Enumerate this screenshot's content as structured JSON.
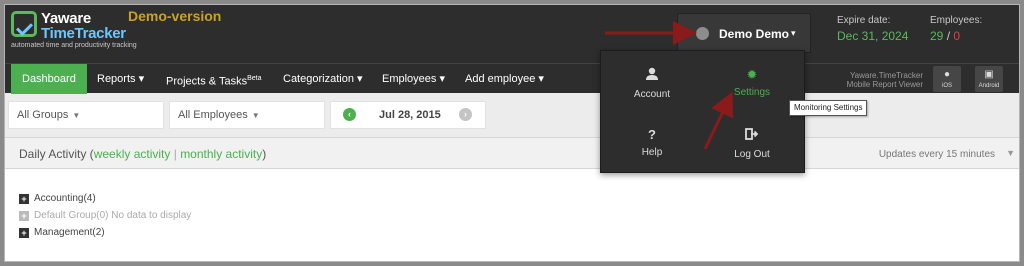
{
  "logo": {
    "line1": "Yaware",
    "line2": "TimeTracker",
    "tagline": "automated time and productivity tracking",
    "demo_label": "Demo-version"
  },
  "user": {
    "name": "Demo Demo",
    "caret": "▾"
  },
  "account_info": {
    "expire_label": "Expire date:",
    "expire_value": "Dec 31, 2024",
    "employees_label": "Employees:",
    "employees_active": "29",
    "employees_sep": "/",
    "employees_inactive": "0"
  },
  "nav": {
    "dashboard": "Dashboard",
    "reports": "Reports ▾",
    "projects": "Projects & Tasks",
    "projects_badge": "Beta",
    "categorization": "Categorization ▾",
    "employees": "Employees ▾",
    "add_employee": "Add employee ▾",
    "mobile_line1": "Yaware.TimeTracker",
    "mobile_line2": "Mobile Report Viewer",
    "ios_label": "iOS",
    "android_label": "Android"
  },
  "filters": {
    "groups": "All Groups",
    "employees": "All Employees",
    "date": "Jul 28, 2015"
  },
  "activity": {
    "title": "Daily Activity (",
    "weekly": "weekly activity",
    "sep": "|",
    "monthly": "monthly activity",
    "close": ")",
    "updates": "Updates every 15 minutes",
    "groups": [
      {
        "label": "Accounting(4)"
      },
      {
        "label": "Default Group(0) No data to display"
      },
      {
        "label": "Management(2)"
      }
    ]
  },
  "menu": {
    "account": "Account",
    "settings": "Settings",
    "help": "Help",
    "logout": "Log Out",
    "tooltip": "Monitoring Settings"
  },
  "colors": {
    "accent_green": "#4caf50",
    "header_dark": "#2d2d2d",
    "annotation_red": "#8b1a1a",
    "logo_blue": "#6ec6ff",
    "demo_gold": "#c9a227"
  },
  "icons": [
    "user-icon",
    "gear-icon",
    "question-icon",
    "logout-icon",
    "apple-icon",
    "android-icon",
    "plus-square-icon"
  ]
}
